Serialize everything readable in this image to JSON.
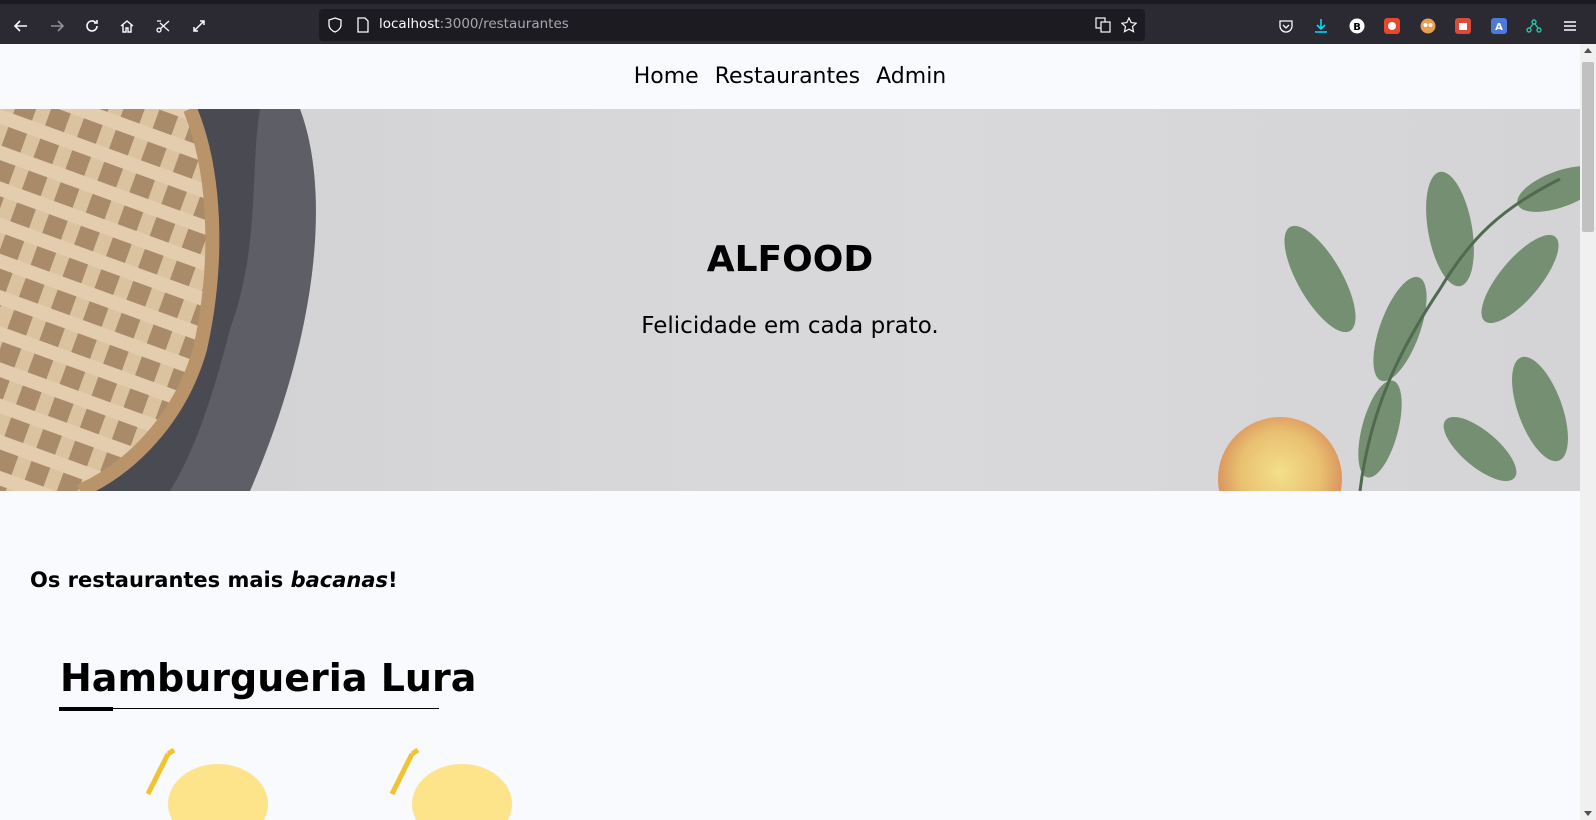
{
  "browser": {
    "url_host": "localhost",
    "url_path": ":3000/restaurantes"
  },
  "nav": {
    "items": [
      "Home",
      "Restaurantes",
      "Admin"
    ]
  },
  "hero": {
    "title": "ALFOOD",
    "subtitle": "Felicidade em cada prato."
  },
  "section": {
    "title_prefix": "Os restaurantes mais ",
    "title_emphasis": "bacanas",
    "title_suffix": "!"
  },
  "restaurant": {
    "name": "Hamburgueria Lura"
  }
}
